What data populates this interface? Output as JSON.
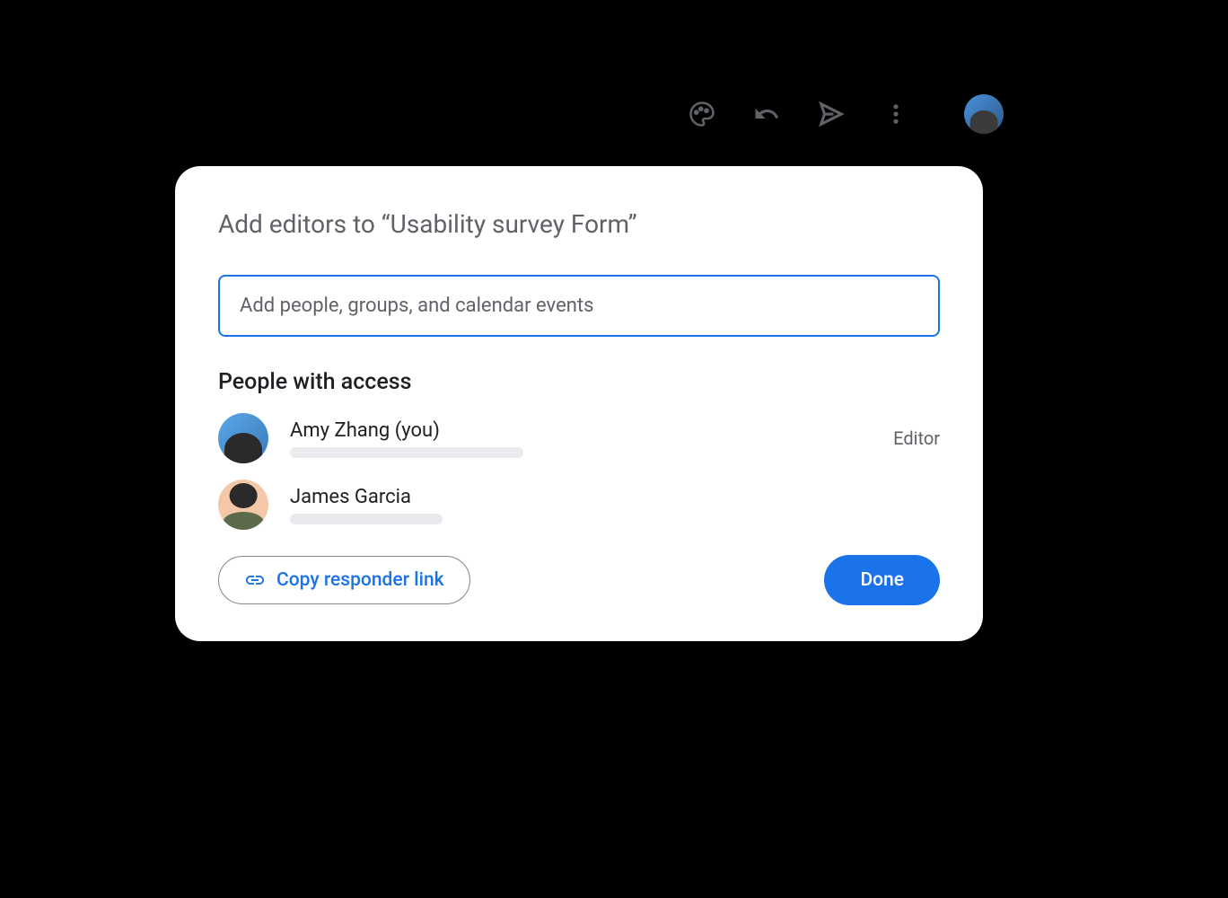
{
  "toolbar": {
    "icons": [
      "palette-icon",
      "undo-icon",
      "send-icon",
      "more-icon"
    ]
  },
  "dialog": {
    "title": "Add editors to “Usability survey Form”",
    "input": {
      "placeholder": "Add people, groups, and calendar events",
      "value": ""
    },
    "section_title": "People with access",
    "people": [
      {
        "name": "Amy Zhang (you)",
        "role": "Editor"
      },
      {
        "name": "James Garcia",
        "role": ""
      }
    ],
    "copy_link_label": "Copy responder link",
    "done_label": "Done"
  }
}
